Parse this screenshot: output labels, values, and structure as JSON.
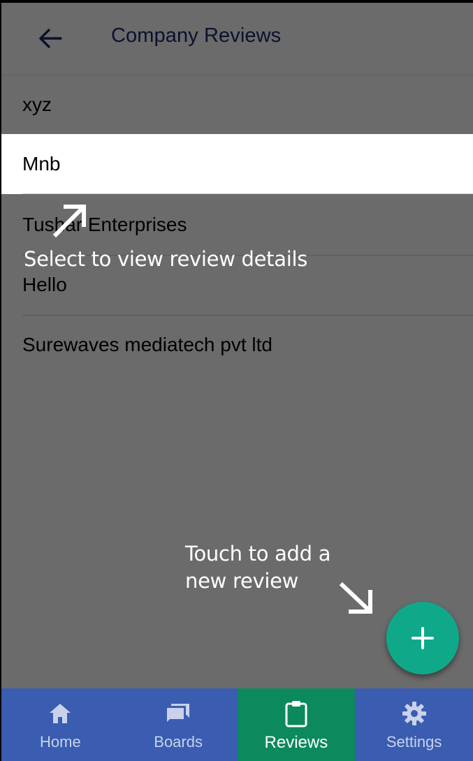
{
  "appbar": {
    "title": "Company Reviews",
    "back_icon": "arrow-left-icon"
  },
  "reviews": [
    {
      "name": "xyz"
    },
    {
      "name": "Mnb"
    },
    {
      "name": "Tushar Enterprises"
    },
    {
      "name": "Hello"
    },
    {
      "name": "Surewaves mediatech pvt ltd"
    }
  ],
  "coach": {
    "select_text": "Select to view review details",
    "add_text_line1": "Touch to add a",
    "add_text_line2": "new review"
  },
  "fab": {
    "icon": "plus-icon",
    "label": "+"
  },
  "bottom_nav": {
    "items": [
      {
        "label": "Home",
        "icon": "home-icon",
        "active": false
      },
      {
        "label": "Boards",
        "icon": "boards-icon",
        "active": false
      },
      {
        "label": "Reviews",
        "icon": "clipboard-icon",
        "active": true
      },
      {
        "label": "Settings",
        "icon": "gear-icon",
        "active": false
      }
    ]
  },
  "colors": {
    "title": "#1d2a6e",
    "fab": "#0fa98a",
    "nav_bg": "#3a5db1",
    "nav_active": "#0c8a5e"
  }
}
